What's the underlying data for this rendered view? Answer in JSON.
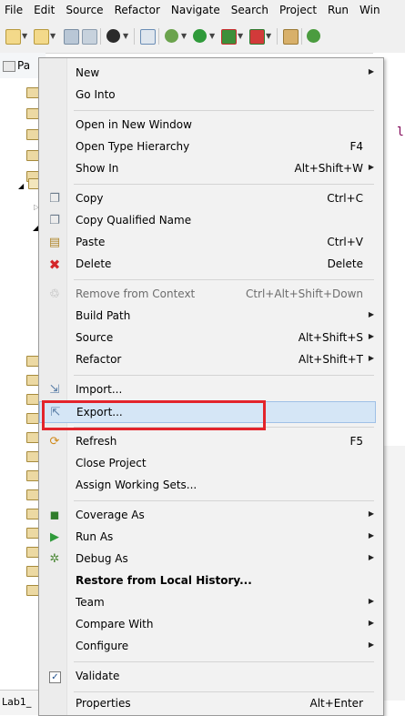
{
  "menubar": [
    "File",
    "Edit",
    "Source",
    "Refactor",
    "Navigate",
    "Search",
    "Project",
    "Run",
    "Win"
  ],
  "package_tab": {
    "label": "Pa"
  },
  "editor_fragment": {
    "text": "l"
  },
  "bottom_tab": {
    "label": "Lab1_"
  },
  "context_menu": {
    "items": [
      {
        "label": "New",
        "shortcut": "",
        "submenu": true,
        "icon": ""
      },
      {
        "label": "Go Into",
        "shortcut": "",
        "submenu": false,
        "icon": ""
      },
      {
        "label": "Open in New Window",
        "shortcut": "",
        "submenu": false,
        "icon": ""
      },
      {
        "label": "Open Type Hierarchy",
        "shortcut": "F4",
        "submenu": false,
        "icon": ""
      },
      {
        "label": "Show In",
        "shortcut": "Alt+Shift+W",
        "submenu": true,
        "icon": ""
      },
      {
        "label": "Copy",
        "shortcut": "Ctrl+C",
        "submenu": false,
        "icon": "copy-icon"
      },
      {
        "label": "Copy Qualified Name",
        "shortcut": "",
        "submenu": false,
        "icon": "copy-qualified-icon"
      },
      {
        "label": "Paste",
        "shortcut": "Ctrl+V",
        "submenu": false,
        "icon": "paste-icon"
      },
      {
        "label": "Delete",
        "shortcut": "Delete",
        "submenu": false,
        "icon": "delete-icon"
      },
      {
        "label": "Remove from Context",
        "shortcut": "Ctrl+Alt+Shift+Down",
        "submenu": false,
        "icon": "remove-context-icon",
        "disabled": true
      },
      {
        "label": "Build Path",
        "shortcut": "",
        "submenu": true,
        "icon": ""
      },
      {
        "label": "Source",
        "shortcut": "Alt+Shift+S",
        "submenu": true,
        "icon": ""
      },
      {
        "label": "Refactor",
        "shortcut": "Alt+Shift+T",
        "submenu": true,
        "icon": ""
      },
      {
        "label": "Import...",
        "shortcut": "",
        "submenu": false,
        "icon": "import-icon"
      },
      {
        "label": "Export...",
        "shortcut": "",
        "submenu": false,
        "icon": "export-icon",
        "selected": true
      },
      {
        "label": "Refresh",
        "shortcut": "F5",
        "submenu": false,
        "icon": "refresh-icon"
      },
      {
        "label": "Close Project",
        "shortcut": "",
        "submenu": false,
        "icon": ""
      },
      {
        "label": "Assign Working Sets...",
        "shortcut": "",
        "submenu": false,
        "icon": ""
      },
      {
        "label": "Coverage As",
        "shortcut": "",
        "submenu": true,
        "icon": "coverage-icon"
      },
      {
        "label": "Run As",
        "shortcut": "",
        "submenu": true,
        "icon": "run-icon"
      },
      {
        "label": "Debug As",
        "shortcut": "",
        "submenu": true,
        "icon": "debug-icon"
      },
      {
        "label": "Restore from Local History...",
        "shortcut": "",
        "submenu": false,
        "icon": ""
      },
      {
        "label": "Team",
        "shortcut": "",
        "submenu": true,
        "icon": ""
      },
      {
        "label": "Compare With",
        "shortcut": "",
        "submenu": true,
        "icon": ""
      },
      {
        "label": "Configure",
        "shortcut": "",
        "submenu": true,
        "icon": ""
      },
      {
        "label": "Validate",
        "shortcut": "",
        "submenu": false,
        "icon": "checkbox-checked-icon"
      },
      {
        "label": "Properties",
        "shortcut": "Alt+Enter",
        "submenu": false,
        "icon": ""
      }
    ]
  },
  "colors": {
    "highlight_border": "#e3242b",
    "selected_bg": "#d5e6f6"
  }
}
